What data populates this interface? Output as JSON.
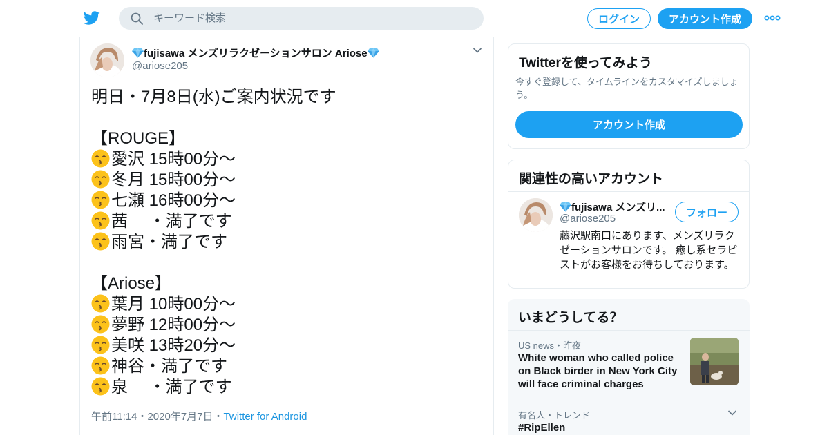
{
  "header": {
    "logo_icon": "twitter-bird-icon",
    "search_placeholder": "キーワード検索",
    "login_label": "ログイン",
    "signup_label": "アカウント作成",
    "more_icon": "more-dots-icon",
    "accent_color": "#1da1f2"
  },
  "tweet": {
    "author_name": "fujisawa メンズリラクゼーションサロン Ariose",
    "author_handle": "@ariose205",
    "lines": [
      {
        "emoji": false,
        "text": "明日・7月8日(水)ご案内状況です"
      },
      {
        "emoji": false,
        "text": ""
      },
      {
        "emoji": false,
        "text": "【ROUGE】"
      },
      {
        "emoji": true,
        "text": "愛沢 15時00分～"
      },
      {
        "emoji": true,
        "text": "冬月 15時00分～"
      },
      {
        "emoji": true,
        "text": "七瀬 16時00分～"
      },
      {
        "emoji": true,
        "text": "茜　 ・満了です"
      },
      {
        "emoji": true,
        "text": "雨宮・満了です"
      },
      {
        "emoji": false,
        "text": ""
      },
      {
        "emoji": false,
        "text": "【Ariose】"
      },
      {
        "emoji": true,
        "text": "葉月 10時00分～"
      },
      {
        "emoji": true,
        "text": "夢野 12時00分～"
      },
      {
        "emoji": true,
        "text": "美咲 13時20分～"
      },
      {
        "emoji": true,
        "text": "神谷・満了です"
      },
      {
        "emoji": true,
        "text": "泉　 ・満了です"
      }
    ],
    "time": "午前11:14",
    "sep": "・",
    "date": "2020年7月7日",
    "source": "Twitter for Android"
  },
  "sidebar": {
    "try": {
      "title": "Twitterを使ってみよう",
      "desc": "今すぐ登録して、タイムラインをカスタマイズしましょう。",
      "button": "アカウント作成"
    },
    "related": {
      "title": "関連性の高いアカウント",
      "name": "fujisawa メンズリ...",
      "handle": "@ariose205",
      "follow_label": "フォロー",
      "bio": "藤沢駅南口にあります、メンズリラクゼーションサロンです。 癒し系セラピストがお客様をお待ちしております。"
    },
    "trends": {
      "title": "いまどうしてる？",
      "items": [
        {
          "context": "US news・昨夜",
          "headline": "White woman who called police on Black birder in New York City will face criminal charges"
        },
        {
          "context": "有名人・トレンド",
          "headline": "#RipEllen"
        }
      ]
    }
  }
}
